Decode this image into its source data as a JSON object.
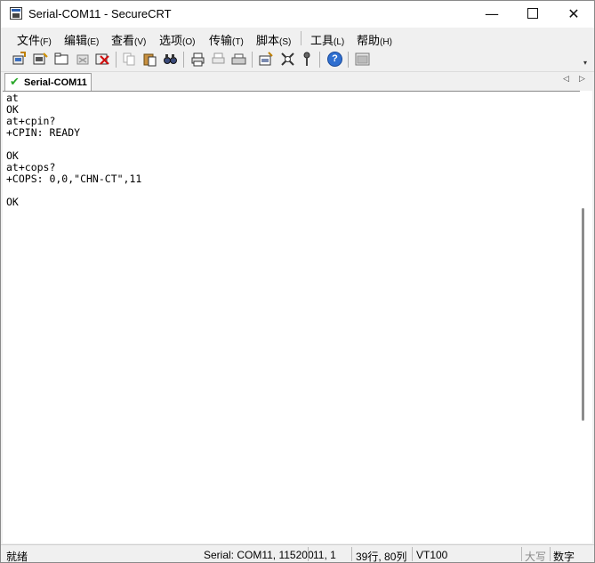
{
  "window": {
    "title": "Serial-COM11 - SecureCRT"
  },
  "title_controls": {
    "minimize": "—",
    "close": "✕"
  },
  "menu": [
    {
      "label": "文件",
      "accel": "(F)"
    },
    {
      "label": "编辑",
      "accel": "(E)"
    },
    {
      "label": "查看",
      "accel": "(V)"
    },
    {
      "label": "选项",
      "accel": "(O)"
    },
    {
      "label": "传输",
      "accel": "(T)"
    },
    {
      "label": "脚本",
      "accel": "(S)"
    },
    {
      "label": "工具",
      "accel": "(L)"
    },
    {
      "label": "帮助",
      "accel": "(H)"
    }
  ],
  "toolbar": {
    "icons": [
      "connect-icon",
      "quick-connect-icon",
      "connect-tab-icon",
      "reconnect-icon",
      "disconnect-icon",
      "copy-icon",
      "paste-icon",
      "find-icon",
      "print-setup-icon",
      "print-selection-icon",
      "print-icon",
      "session-options-icon",
      "global-options-icon",
      "key-map-icon",
      "help-icon",
      "sftp-icon"
    ],
    "help_glyph": "?",
    "overflow_glyph": "▾"
  },
  "tabs": [
    {
      "label": "Serial-COM11",
      "active": true,
      "status_glyph": "✔"
    }
  ],
  "tab_nav": {
    "prev": "◁",
    "next": "▷"
  },
  "terminal": {
    "lines": [
      "at",
      "OK",
      "at+cpin?",
      "+CPIN: READY",
      "",
      "OK",
      "at+cops?",
      "+COPS: 0,0,\"CHN-CT\",11",
      "",
      "OK"
    ]
  },
  "scrollbar": {
    "position": 0.49,
    "thumb_fraction": 0.47
  },
  "status": {
    "ready": "就绪",
    "connection": "Serial: COM11, 115200",
    "cursor": "11,  1",
    "size": "39行, 80列",
    "emulation": "VT100",
    "caps": "大写",
    "num": "数字"
  }
}
